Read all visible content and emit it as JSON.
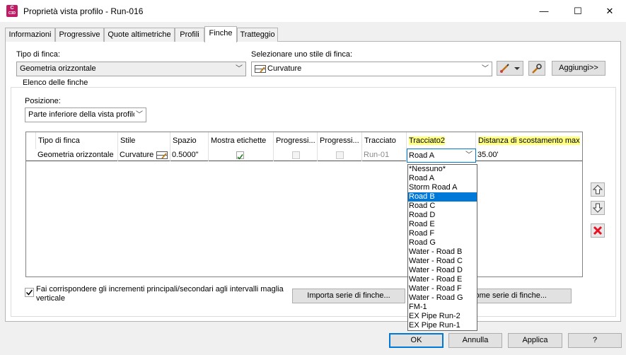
{
  "window": {
    "title": "Proprietà vista profilo - Run-016",
    "app_icon_text": "C",
    "app_icon_sub": "C3D",
    "minimize": "—",
    "maximize": "☐",
    "close": "✕"
  },
  "tabs": [
    "Informazioni",
    "Progressive",
    "Quote altimetriche",
    "Profili",
    "Finche",
    "Tratteggio"
  ],
  "active_tab": "Finche",
  "form": {
    "band_type_label": "Tipo di finca:",
    "band_type_value": "Geometria orizzontale",
    "band_style_label": "Selezionare uno stile di finca:",
    "band_style_value": "Curvature",
    "add_button": "Aggiungi>>",
    "group_label": "Elenco delle finche",
    "position_label": "Posizione:",
    "position_value": "Parte inferiore della vista profilo"
  },
  "grid": {
    "headers": [
      "Tipo di finca",
      "Stile",
      "Spazio",
      "Mostra etichette",
      "Progressi...",
      "Progressi...",
      "Tracciato",
      "Tracciato2",
      "Distanza di scostamento max"
    ],
    "row": {
      "band_type": "Geometria orizzontale",
      "style": "Curvature",
      "gap": "0.5000\"",
      "show_labels": true,
      "prog1": false,
      "prog2": false,
      "alignment": "Run-01",
      "alignment2": "Road A",
      "offset": "35.00'"
    }
  },
  "dropdown": {
    "items": [
      "*Nessuno*",
      "Road A",
      "Storm Road A",
      "Road B",
      "Road C",
      "Road D",
      "Road E",
      "Road F",
      "Road G",
      "Water - Road B",
      "Water - Road C",
      "Water - Road D",
      "Water - Road E",
      "Water - Road F",
      "Water - Road G",
      "FM-1",
      "EX Pipe Run-2",
      "EX Pipe Run-1"
    ],
    "selected": "Road B"
  },
  "footer": {
    "match_checkbox_label": "Fai corrispondere gli incrementi principali/secondari agli intervalli maglia verticale",
    "match_checked": true,
    "import_button": "Importa serie di finche...",
    "save_button_partial": "ome serie di finche..."
  },
  "buttons": {
    "ok": "OK",
    "cancel": "Annulla",
    "apply": "Applica",
    "help": "?"
  },
  "colors": {
    "highlight_header": "#ffff80",
    "selection": "#0078d7",
    "delete_red": "#e81123"
  }
}
